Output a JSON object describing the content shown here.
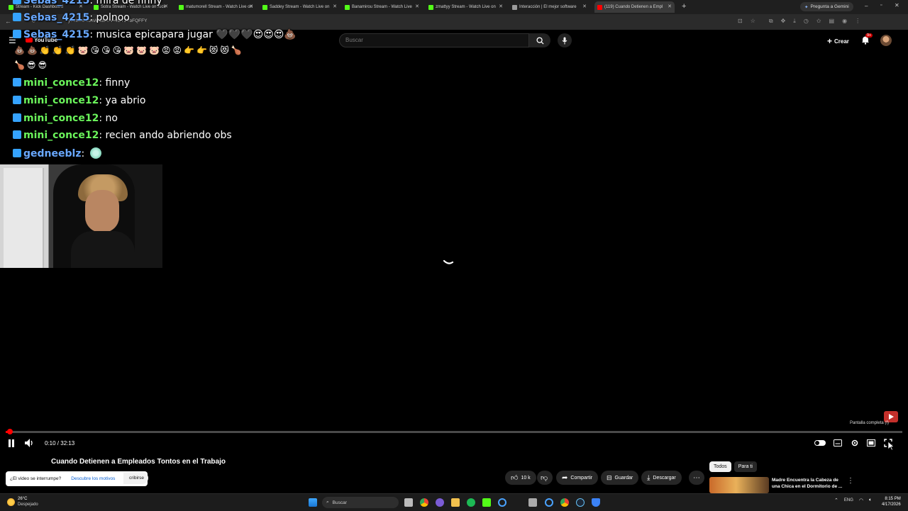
{
  "browser": {
    "tabs": [
      {
        "label": "Stream - Kick Dashboard",
        "color": "#53fc18",
        "active": false
      },
      {
        "label": "Sotra Stream - Watch Live on Kick",
        "color": "#53fc18",
        "active": false
      },
      {
        "label": "matumorell Stream - Watch Live on",
        "color": "#53fc18",
        "active": false
      },
      {
        "label": "Saddey Stream - Watch Live on",
        "color": "#53fc18",
        "active": false
      },
      {
        "label": "Banamirou Stream - Watch Live",
        "color": "#53fc18",
        "active": false
      },
      {
        "label": "zmattyy Stream - Watch Live on",
        "color": "#53fc18",
        "active": false
      },
      {
        "label": "Interacción | El mejor software",
        "color": "#9b9b9b",
        "active": false
      },
      {
        "label": "(119) Cuando Detienen a Empl",
        "color": "#ff0000",
        "active": true
      }
    ],
    "new_tab": "+",
    "gemini_button": "Pregunta a Gemini",
    "url": "youtube.com/watch?v=vDT3YbFQFFY"
  },
  "youtube": {
    "logo_text": "YouTube",
    "search_placeholder": "Buscar",
    "create_label": "Crear",
    "notif_count": "9+"
  },
  "chat": [
    {
      "user": "Sebas_4215",
      "message": "mira de finny",
      "color": "blue"
    },
    {
      "user": "Sebas_4215",
      "message": "polnoo",
      "color": "blue"
    },
    {
      "user": "Sebas_4215",
      "message": "musica epicapara jugar 🖤🖤🖤😍😍😍💩",
      "color": "blue"
    },
    {
      "user": "",
      "message": "💩💩👏👏👏🐷😘😘😘🐷🐷🐷😡😡👉👉😻😻🍗",
      "color": ""
    },
    {
      "user": "",
      "message": "🍗😎😎",
      "color": ""
    },
    {
      "user": "mini_conce12",
      "message": "finny",
      "color": "green"
    },
    {
      "user": "mini_conce12",
      "message": "ya abrio",
      "color": "green"
    },
    {
      "user": "mini_conce12",
      "message": "no",
      "color": "green"
    },
    {
      "user": "mini_conce12",
      "message": "recien ando abriendo obs",
      "color": "green"
    },
    {
      "user": "gedneeblz",
      "message": "",
      "color": "blue"
    }
  ],
  "player": {
    "progress": 0.005,
    "time": "0:10 / 32:13",
    "fullscreen_tooltip": "Pantalla completa (f)",
    "accent": "#ff0000"
  },
  "video": {
    "title": "Cuando Detienen a Empleados Tontos en el Trabajo",
    "subscribe_label": "cribirse",
    "like_count": "10 k",
    "share_label": "Compartir",
    "save_label": "Guardar",
    "download_label": "Descargar"
  },
  "interrupt_banner": {
    "question": "¿El video se interrumpe?",
    "link": "Descubre los motivos"
  },
  "recommendations": {
    "chips": [
      "Todos",
      "Para ti"
    ],
    "first_title": "Madre Encuentra la Cabeza de una Chica en el Dormitorio de ..."
  },
  "taskbar": {
    "weather_temp": "26°C",
    "weather_desc": "Despejado",
    "search_label": "Buscar",
    "lang": "ENG",
    "time": "8:15 PM",
    "date": "4/17/2026"
  }
}
